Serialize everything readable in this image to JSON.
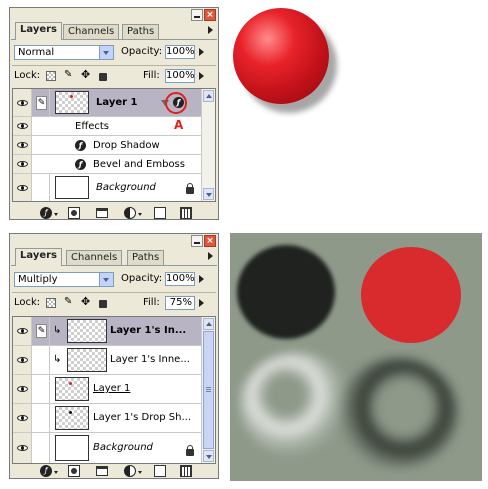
{
  "top_panel": {
    "tabs": [
      "Layers",
      "Channels",
      "Paths"
    ],
    "blend_mode": "Normal",
    "opacity_label": "Opacity:",
    "opacity_value": "100%",
    "lock_label": "Lock:",
    "fill_label": "Fill:",
    "fill_value": "100%",
    "layers": {
      "layer1": "Layer 1",
      "effects": "Effects",
      "drop_shadow": "Drop Shadow",
      "bevel_emboss": "Bevel and Emboss",
      "background": "Background"
    },
    "annotation": "A",
    "close_glyph": "×"
  },
  "bottom_panel": {
    "tabs": [
      "Layers",
      "Channels",
      "Paths"
    ],
    "blend_mode": "Multiply",
    "opacity_label": "Opacity:",
    "opacity_value": "100%",
    "lock_label": "Lock:",
    "fill_label": "Fill:",
    "fill_value": "75%",
    "layers": [
      {
        "name": "Layer 1's In...",
        "selected": true,
        "clipped": true
      },
      {
        "name": "Layer 1's Inne...",
        "selected": false,
        "clipped": true
      },
      {
        "name": "Layer 1",
        "selected": false,
        "clipped": false
      },
      {
        "name": "Layer 1's Drop Sh...",
        "selected": false,
        "clipped": false
      },
      {
        "name": "Background",
        "selected": false,
        "clipped": false
      }
    ],
    "close_glyph": "×"
  },
  "icons": {
    "fx": "ƒ",
    "brush": "✎",
    "move": "✥",
    "clip_arrow": "↳"
  },
  "colors": {
    "sphere_red": "#d7222a",
    "canvas_bg": "#8e998a",
    "dark_circle": "#1f221f",
    "red_circle": "#d92a2e",
    "annotation_red": "#e02020"
  }
}
